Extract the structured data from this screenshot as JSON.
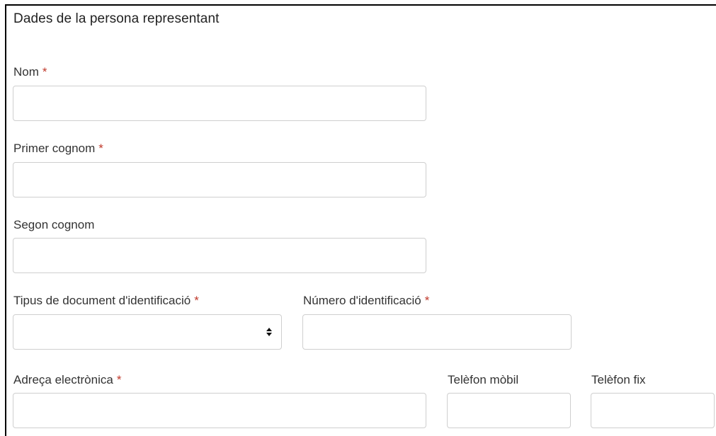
{
  "section": {
    "title": "Dades de la persona representant"
  },
  "fields": {
    "nom": {
      "label": "Nom",
      "required_mark": "*",
      "value": ""
    },
    "primer_cognom": {
      "label": "Primer cognom",
      "required_mark": "*",
      "value": ""
    },
    "segon_cognom": {
      "label": "Segon cognom",
      "value": ""
    },
    "tipus_document": {
      "label": "Tipus de document d'identificació",
      "required_mark": "*",
      "selected": ""
    },
    "numero_identificacio": {
      "label": "Número d'identificació",
      "required_mark": "*",
      "value": ""
    },
    "adreca_electronica": {
      "label": "Adreça electrònica",
      "required_mark": "*",
      "value": ""
    },
    "telefon_mobil": {
      "label": "Telèfon mòbil",
      "value": ""
    },
    "telefon_fix": {
      "label": "Telèfon fix",
      "value": ""
    }
  },
  "colors": {
    "required": "#c0392b",
    "border": "#cfcfcf",
    "text": "#333333"
  },
  "icons": {
    "select_arrow": "up-down-arrows-icon"
  }
}
